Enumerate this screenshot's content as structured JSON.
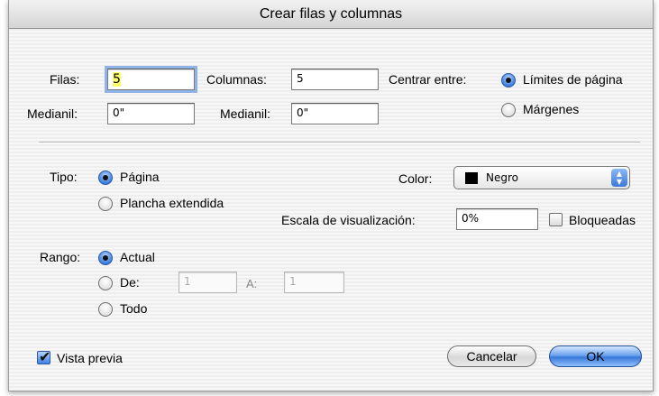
{
  "dialog": {
    "title": "Crear filas y columnas"
  },
  "grid": {
    "rows_label": "Filas:",
    "rows_value": "5",
    "columns_label": "Columnas:",
    "columns_value": "5",
    "gutter_label_1": "Medianil:",
    "gutter_value_1": "0\"",
    "gutter_label_2": "Medianil:",
    "gutter_value_2": "0\""
  },
  "center": {
    "label": "Centrar entre:",
    "options": [
      "Límites de página",
      "Márgenes"
    ],
    "selected": "Límites de página"
  },
  "type": {
    "label": "Tipo:",
    "options": [
      "Página",
      "Plancha extendida"
    ],
    "selected": "Página"
  },
  "color": {
    "label": "Color:",
    "value": "Negro",
    "swatch": "#000000"
  },
  "scale": {
    "label": "Escala de visualización:",
    "value": "0%",
    "locked_label": "Bloqueadas",
    "locked": false
  },
  "range": {
    "label": "Rango:",
    "options": [
      "Actual",
      "De:",
      "Todo"
    ],
    "selected": "Actual",
    "from_value": "1",
    "to_label": "A:",
    "to_value": "1"
  },
  "preview": {
    "label": "Vista previa",
    "checked": true
  },
  "buttons": {
    "cancel": "Cancelar",
    "ok": "OK"
  }
}
